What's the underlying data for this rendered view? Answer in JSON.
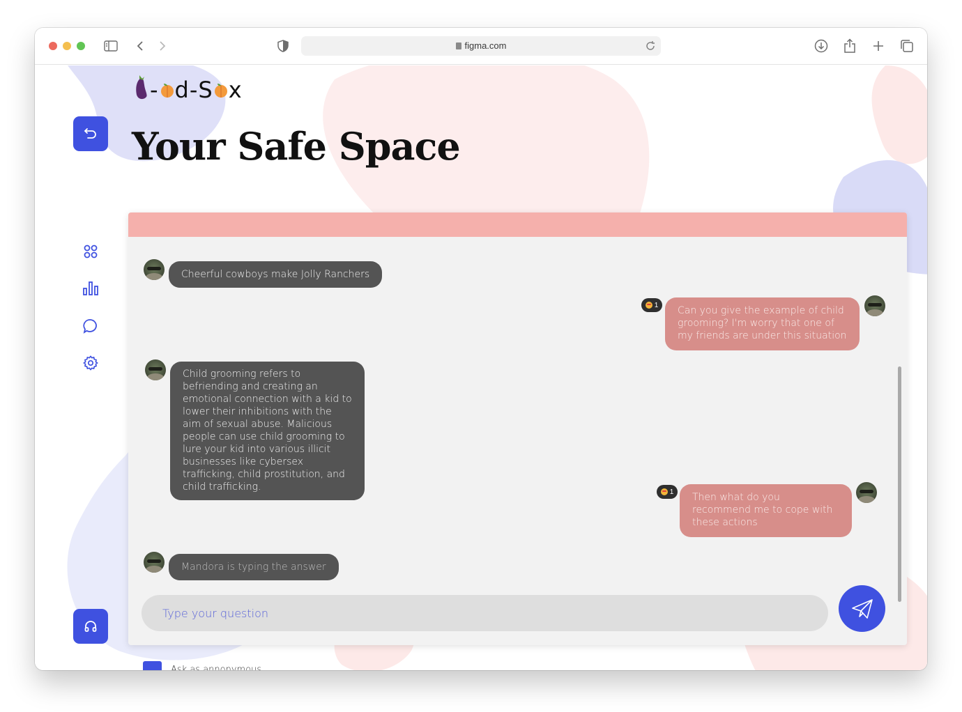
{
  "browser": {
    "url": "figma.com"
  },
  "app": {
    "logo_text": "d-S",
    "logo_suffix": "x",
    "title": "Your Safe Space"
  },
  "sidebar": {
    "items": [
      {
        "name": "dashboard",
        "icon": "grid-icon"
      },
      {
        "name": "stats",
        "icon": "bar-chart-icon"
      },
      {
        "name": "chat",
        "icon": "chat-bubble-icon"
      },
      {
        "name": "settings",
        "icon": "gear-icon"
      }
    ],
    "top_button_icon": "undo-icon",
    "bottom_button_icon": "headphones-icon"
  },
  "chat": {
    "messages": [
      {
        "from": "bot",
        "text": "Cheerful cowboys make Jolly Ranchers"
      },
      {
        "from": "user",
        "text": "Can you give the example of child grooming? I'm worry that one of my friends are under this situation",
        "reaction_count": "1"
      },
      {
        "from": "bot",
        "text": "Child grooming refers to befriending and creating an emotional connection with a kid to lower their inhibitions with the aim of sexual abuse. Malicious people can use child grooming to lure your kid into various illicit businesses like cybersex trafficking, child prostitution, and child trafficking."
      },
      {
        "from": "user",
        "text": "Then what do you recommend me to cope with these actions",
        "reaction_count": "1"
      },
      {
        "from": "bot",
        "text": "Mandora is typing the answer"
      }
    ],
    "input_placeholder": "Type your question",
    "send_icon": "paper-plane-icon"
  },
  "anonymous": {
    "label": "Ask as annonymous"
  },
  "colors": {
    "accent": "#3f51e0",
    "header": "#f5b0ac",
    "bot_bubble": "#545454",
    "user_bubble": "#d78e8a"
  }
}
